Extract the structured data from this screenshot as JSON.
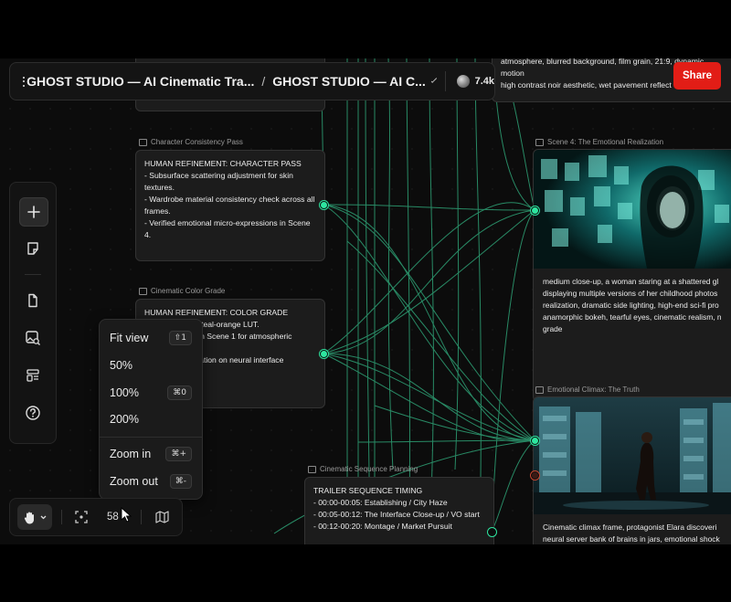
{
  "header": {
    "breadcrumb_1": "GHOST STUDIO — AI Cinematic Tra...",
    "breadcrumb_sep": "/",
    "breadcrumb_2": "GHOST STUDIO — AI C...",
    "view_count": "7.4k",
    "share_label": "Share"
  },
  "nodes": {
    "top_partial_text": "atmosphere, blurred background, film grain, 21:9, dynamic motion\nhigh contrast noir aesthetic, wet pavement reflect",
    "character": {
      "label": "Character Consistency Pass",
      "text": "HUMAN REFINEMENT: CHARACTER PASS\n- Subsurface scattering adjustment for skin textures.\n- Wardrobe material consistency check across all frames.\n- Verified emotional micro-expressions in Scene 4."
    },
    "color": {
      "label": "Cinematic Color Grade",
      "text": "HUMAN REFINEMENT: COLOR GRADE\n                      m teal-orange LUT.\n                      s in Scene 1 for atmospheric\n\n                      eration on neural interface"
    },
    "sequence": {
      "label": "Cinematic Sequence Planning",
      "text": "TRAILER SEQUENCE TIMING\n- 00:00-00:05: Establishing / City Haze\n- 00:05-00:12: The Interface Close-up / VO start\n- 00:12-00:20: Montage / Market Pursuit"
    },
    "scene4": {
      "label": "Scene 4: The Emotional Realization",
      "text": "medium close-up, a woman staring at a shattered gl displaying multiple versions of her childhood photos realization, dramatic side lighting, high-end sci-fi pro anamorphic bokeh, tearful eyes, cinematic realism, n grade"
    },
    "climax": {
      "label": "Emotional Climax: The Truth",
      "text": "Cinematic climax frame, protagonist Elara discoveri neural server bank of brains in jars, emotional shock"
    }
  },
  "zoom_menu": {
    "items": [
      {
        "label": "Fit view",
        "shortcut": "⇧1"
      },
      {
        "label": "50%",
        "shortcut": ""
      },
      {
        "label": "100%",
        "shortcut": "⌘0"
      },
      {
        "label": "200%",
        "shortcut": ""
      },
      {
        "label": "Zoom in",
        "shortcut": "⌘+"
      },
      {
        "label": "Zoom out",
        "shortcut": "⌘-"
      }
    ]
  },
  "bottom_bar": {
    "zoom_level": "58"
  },
  "icons": {
    "menu": "hamburger-icon",
    "add": "plus-icon",
    "sticky": "sticky-note-icon",
    "document": "document-icon",
    "image_search": "image-search-icon",
    "layout": "layout-icon",
    "help": "help-icon",
    "hand": "hand-tool-icon",
    "fit": "fit-screen-icon",
    "minimap": "map-icon"
  },
  "colors": {
    "accent": "#2ee6a0",
    "share": "#e21d16",
    "background": "#0c0c0c"
  }
}
